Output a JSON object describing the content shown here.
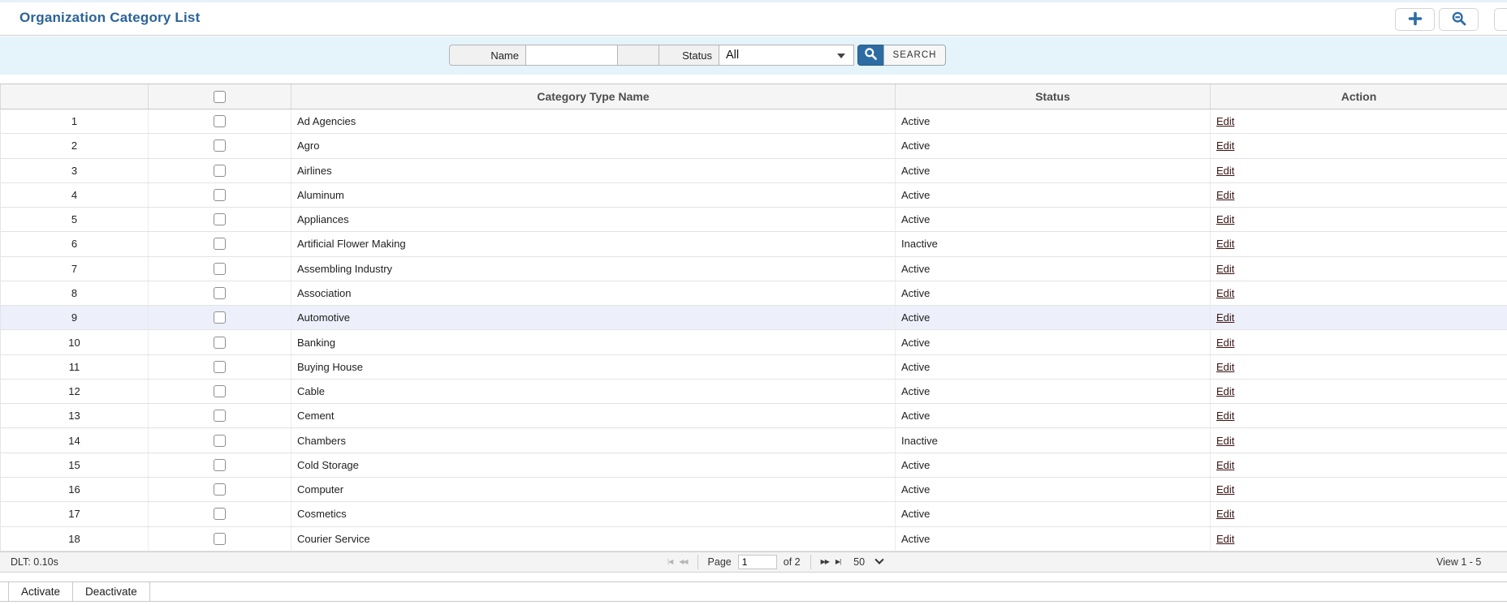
{
  "header": {
    "title": "Organization Category List",
    "icons": [
      {
        "name": "add-icon",
        "meaning": "plus"
      },
      {
        "name": "zoom-out-icon",
        "meaning": "magnifier-minus"
      },
      {
        "name": "partial-icon",
        "meaning": "clipped gray glyph at screen edge"
      }
    ]
  },
  "search": {
    "name_label": "Name",
    "name_value": "",
    "status_label": "Status",
    "status_value": "All",
    "search_button": "SEARCH",
    "magnifier_icon": "search-icon"
  },
  "table": {
    "columns": {
      "category": "Category Type Name",
      "status": "Status",
      "action": "Action"
    },
    "action_label": "Edit",
    "selected_row": "9",
    "rows": [
      {
        "num": "1",
        "name": "Ad Agencies",
        "status": "Active"
      },
      {
        "num": "2",
        "name": "Agro",
        "status": "Active"
      },
      {
        "num": "3",
        "name": "Airlines",
        "status": "Active"
      },
      {
        "num": "4",
        "name": "Aluminum",
        "status": "Active"
      },
      {
        "num": "5",
        "name": "Appliances",
        "status": "Active"
      },
      {
        "num": "6",
        "name": "Artificial Flower Making",
        "status": "Inactive"
      },
      {
        "num": "7",
        "name": "Assembling Industry",
        "status": "Active"
      },
      {
        "num": "8",
        "name": "Association",
        "status": "Active"
      },
      {
        "num": "9",
        "name": "Automotive",
        "status": "Active"
      },
      {
        "num": "10",
        "name": "Banking",
        "status": "Active"
      },
      {
        "num": "11",
        "name": "Buying House",
        "status": "Active"
      },
      {
        "num": "12",
        "name": "Cable",
        "status": "Active"
      },
      {
        "num": "13",
        "name": "Cement",
        "status": "Active"
      },
      {
        "num": "14",
        "name": "Chambers",
        "status": "Inactive"
      },
      {
        "num": "15",
        "name": "Cold Storage",
        "status": "Active"
      },
      {
        "num": "16",
        "name": "Computer",
        "status": "Active"
      },
      {
        "num": "17",
        "name": "Cosmetics",
        "status": "Active"
      },
      {
        "num": "18",
        "name": "Courier Service",
        "status": "Active"
      }
    ]
  },
  "pager": {
    "dlt": "DLT: 0.10s",
    "page_label": "Page",
    "page_value": "1",
    "of_label": "of 2",
    "rows_per_page": "50",
    "view_info": "View 1 - 5",
    "icons": {
      "first": "|◀",
      "previous": "◀◀",
      "next": "▶▶",
      "last": "▶|"
    }
  },
  "footer": {
    "activate": "Activate",
    "deactivate": "Deactivate"
  },
  "colors": {
    "title_text": "#2b6399",
    "accent_blue": "#2d6ca2",
    "search_band": "#e5f3fa",
    "header_bg": "#f5f5f5",
    "selected_row_bg": "#edf0fb",
    "edit_link": "#3b1413"
  }
}
